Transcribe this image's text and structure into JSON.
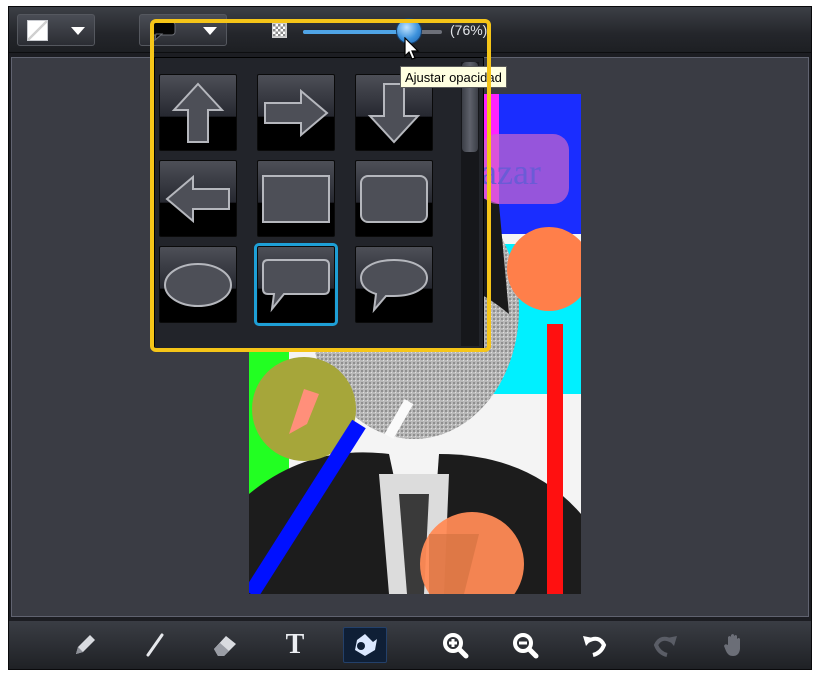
{
  "toolbar": {
    "line_color_dropdown": "line-color-swatch",
    "shape_dropdown": "shape-picker",
    "opacity": {
      "icon": "checkerboard-icon",
      "value": 0.76,
      "label": "(76%)",
      "tooltip": "Ajustar opacidad"
    }
  },
  "shape_popup": {
    "shapes": [
      {
        "name": "arrow-up-shape"
      },
      {
        "name": "arrow-right-shape"
      },
      {
        "name": "arrow-down-shape"
      },
      {
        "name": "arrow-left-shape"
      },
      {
        "name": "rectangle-shape"
      },
      {
        "name": "rounded-rectangle-shape"
      },
      {
        "name": "ellipse-shape"
      },
      {
        "name": "rectangle-callout-shape"
      },
      {
        "name": "oval-callout-shape"
      }
    ],
    "selected": 7
  },
  "canvas": {
    "photo_text": "azar"
  },
  "bottom_tools": [
    {
      "name": "pencil-tool",
      "icon": "pencil-icon"
    },
    {
      "name": "line-tool",
      "icon": "line-icon"
    },
    {
      "name": "eraser-tool",
      "icon": "eraser-icon"
    },
    {
      "name": "text-tool",
      "icon": "text-icon",
      "label": "T"
    },
    {
      "name": "shape-tool",
      "icon": "shapes-icon",
      "active": true
    },
    {
      "name": "zoom-in-tool",
      "icon": "zoom-in-icon"
    },
    {
      "name": "zoom-out-tool",
      "icon": "zoom-out-icon"
    },
    {
      "name": "undo-tool",
      "icon": "undo-icon"
    },
    {
      "name": "redo-tool",
      "icon": "redo-icon",
      "disabled": true
    },
    {
      "name": "pan-tool",
      "icon": "hand-icon"
    }
  ],
  "colors": {
    "highlight": "#f5c518",
    "selection": "#1e9fd6",
    "slider_fill": "#4fa4e6"
  }
}
